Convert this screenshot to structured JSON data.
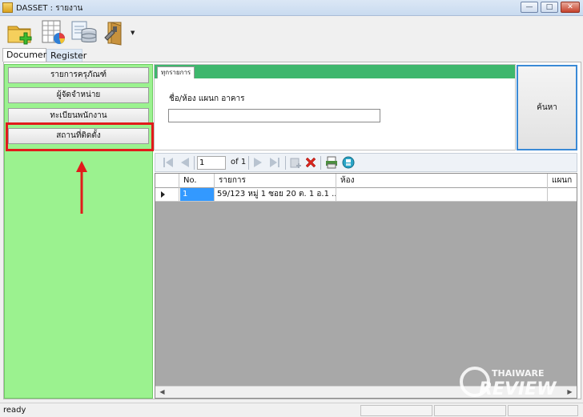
{
  "window": {
    "title": "DASSET : รายงาน",
    "buttons": [
      "—",
      "□",
      "✕"
    ]
  },
  "toolbar": {
    "icons": [
      "folder-add-icon",
      "spreadsheet-chart-icon",
      "database-doc-icon",
      "tools-folder-icon"
    ]
  },
  "tabs": [
    {
      "label": "Document"
    },
    {
      "label": "Register"
    }
  ],
  "nav": {
    "items": [
      {
        "label": "รายการครุภัณฑ์"
      },
      {
        "label": "ผู้จัดจำหน่าย"
      },
      {
        "label": "ทะเบียนพนักงาน"
      },
      {
        "label": "สถานที่ติดตั้ง"
      }
    ]
  },
  "search": {
    "tab_label": "ทุกรายการ",
    "field_label": "ชื่อ/ห้อง แผนก อาคาร",
    "field_value": "",
    "button_label": "ค้นหา"
  },
  "pager": {
    "current_page": "1",
    "of_label": "of 1"
  },
  "grid": {
    "columns": [
      {
        "label": "No."
      },
      {
        "label": "รายการ"
      },
      {
        "label": "ห้อง"
      },
      {
        "label": "แผนก"
      }
    ],
    "rows": [
      {
        "no": "1",
        "item": "59/123 หมู่ 1 ซอย 20 ต. 1 อ.1 ...",
        "room": "",
        "dept": ""
      }
    ]
  },
  "status": {
    "text": "ready"
  },
  "watermark": {
    "line1": "THAIWARE",
    "line2": "REVIEW"
  },
  "colors": {
    "panel_green": "#9bf28f",
    "strip_green": "#3eb76d",
    "highlight_red": "#e11b1b",
    "selection_blue": "#3399ff"
  }
}
